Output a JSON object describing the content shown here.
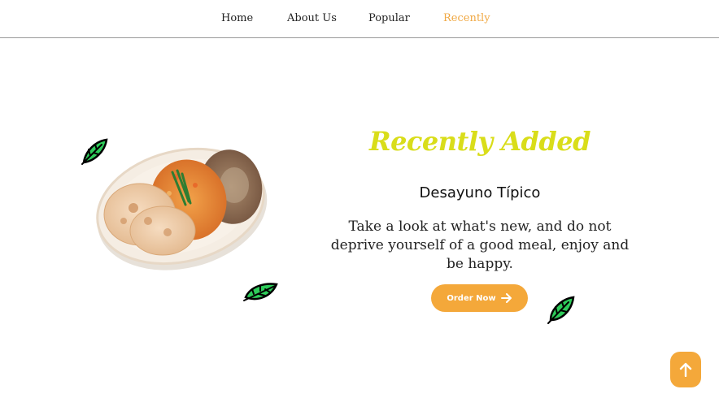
{
  "nav": {
    "items": [
      {
        "label": "Home",
        "active": false
      },
      {
        "label": "About Us",
        "active": false
      },
      {
        "label": "Popular",
        "active": false
      },
      {
        "label": "Recently",
        "active": true
      }
    ]
  },
  "section": {
    "title": "Recently Added",
    "dish_name": "Desayuno Típico",
    "description": "Take a look at what's new, and do not deprive yourself of a good meal, enjoy and be happy.",
    "button_label": "Order Now"
  },
  "colors": {
    "accent": "#f4a83a",
    "title": "#d9dd1a",
    "leaf": "#2ecc5a"
  },
  "icons": [
    "leaf-icon",
    "arrow-right-icon",
    "arrow-up-icon"
  ]
}
